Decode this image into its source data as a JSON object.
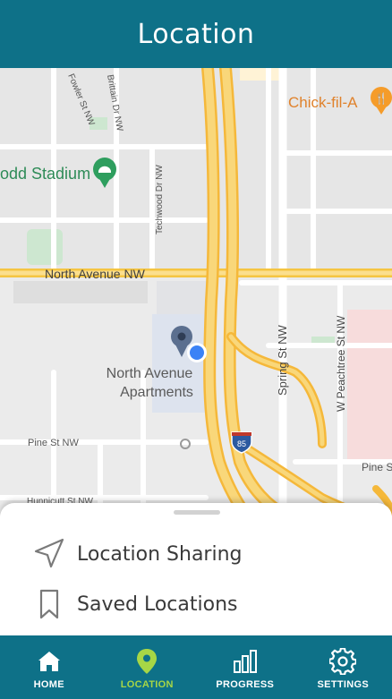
{
  "header": {
    "title": "Location"
  },
  "map": {
    "poi": {
      "stadium": "odd Stadium",
      "restaurant": "Chick-fil-A",
      "apartments_line1": "North Avenue",
      "apartments_line2": "Apartments"
    },
    "streets": {
      "north_avenue": "North Avenue NW",
      "fowler": "Fowler St NW",
      "brittain": "Brittain Dr NW",
      "techwood": "Techwood Dr NW",
      "spring": "Spring St NW",
      "peachtree": "W Peachtree St NW",
      "pine_left": "Pine St NW",
      "pine_right": "Pine St",
      "hunnicutt": "Hunnicutt St NW",
      "interstate": "85"
    }
  },
  "sheet": {
    "items": [
      {
        "label": "Location Sharing",
        "icon": "navigation-arrow-icon"
      },
      {
        "label": "Saved Locations",
        "icon": "bookmark-icon"
      }
    ]
  },
  "nav": {
    "active": "location",
    "items": [
      {
        "label": "HOME",
        "icon": "home-icon"
      },
      {
        "label": "LOCATION",
        "icon": "map-pin-icon"
      },
      {
        "label": "PROGRESS",
        "icon": "bar-chart-icon"
      },
      {
        "label": "SETTINGS",
        "icon": "gear-icon"
      }
    ]
  },
  "colors": {
    "header_bg": "#0e7188",
    "nav_active": "#a7d646",
    "highway": "#f6c344",
    "user_dot": "#3b82f6"
  }
}
